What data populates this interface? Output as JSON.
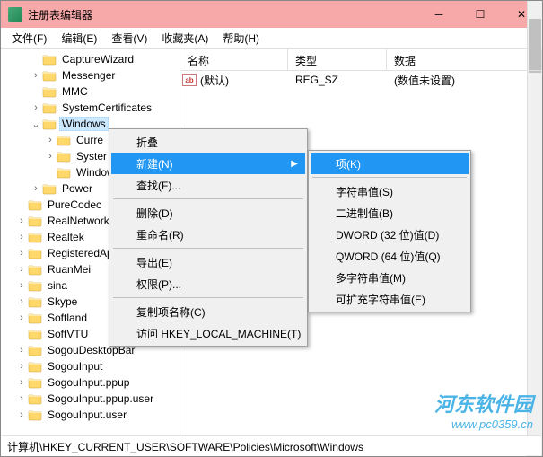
{
  "window": {
    "title": "注册表编辑器",
    "min": "─",
    "max": "☐",
    "close": "✕"
  },
  "menubar": [
    "文件(F)",
    "编辑(E)",
    "查看(V)",
    "收藏夹(A)",
    "帮助(H)"
  ],
  "tree": [
    {
      "d": 2,
      "e": "",
      "n": "CaptureWizard"
    },
    {
      "d": 2,
      "e": "›",
      "n": "Messenger"
    },
    {
      "d": 2,
      "e": "",
      "n": "MMC"
    },
    {
      "d": 2,
      "e": "›",
      "n": "SystemCertificates"
    },
    {
      "d": 2,
      "e": "⌄",
      "n": "Windows",
      "sel": true
    },
    {
      "d": 3,
      "e": "›",
      "n": "Curre"
    },
    {
      "d": 3,
      "e": "›",
      "n": "Syster"
    },
    {
      "d": 3,
      "e": "",
      "n": "Windows"
    },
    {
      "d": 2,
      "e": "›",
      "n": "Power"
    },
    {
      "d": 1,
      "e": "",
      "n": "PureCodec"
    },
    {
      "d": 1,
      "e": "›",
      "n": "RealNetworks"
    },
    {
      "d": 1,
      "e": "›",
      "n": "Realtek"
    },
    {
      "d": 1,
      "e": "›",
      "n": "RegisteredAppl"
    },
    {
      "d": 1,
      "e": "›",
      "n": "RuanMei"
    },
    {
      "d": 1,
      "e": "›",
      "n": "sina"
    },
    {
      "d": 1,
      "e": "›",
      "n": "Skype"
    },
    {
      "d": 1,
      "e": "›",
      "n": "Softland"
    },
    {
      "d": 1,
      "e": "",
      "n": "SoftVTU"
    },
    {
      "d": 1,
      "e": "›",
      "n": "SogouDesktopBar"
    },
    {
      "d": 1,
      "e": "›",
      "n": "SogouInput"
    },
    {
      "d": 1,
      "e": "›",
      "n": "SogouInput.ppup"
    },
    {
      "d": 1,
      "e": "›",
      "n": "SogouInput.ppup.user"
    },
    {
      "d": 1,
      "e": "›",
      "n": "SogouInput.user"
    }
  ],
  "listhead": {
    "c1": "名称",
    "c2": "类型",
    "c3": "数据"
  },
  "listrow": {
    "name": "(默认)",
    "type": "REG_SZ",
    "data": "(数值未设置)"
  },
  "ctx1": [
    {
      "t": "折叠"
    },
    {
      "t": "新建(N)",
      "hl": true,
      "sub": true
    },
    {
      "t": "查找(F)..."
    },
    {
      "sep": true
    },
    {
      "t": "删除(D)"
    },
    {
      "t": "重命名(R)"
    },
    {
      "sep": true
    },
    {
      "t": "导出(E)"
    },
    {
      "t": "权限(P)..."
    },
    {
      "sep": true
    },
    {
      "t": "复制项名称(C)"
    },
    {
      "t": "访问 HKEY_LOCAL_MACHINE(T)"
    }
  ],
  "ctx2": [
    {
      "t": "项(K)",
      "hl": true
    },
    {
      "sep": true
    },
    {
      "t": "字符串值(S)"
    },
    {
      "t": "二进制值(B)"
    },
    {
      "t": "DWORD (32 位)值(D)"
    },
    {
      "t": "QWORD (64 位)值(Q)"
    },
    {
      "t": "多字符串值(M)"
    },
    {
      "t": "可扩充字符串值(E)"
    }
  ],
  "statusbar": "计算机\\HKEY_CURRENT_USER\\SOFTWARE\\Policies\\Microsoft\\Windows",
  "watermark": {
    "title": "河东软件园",
    "url": "www.pc0359.cn"
  }
}
